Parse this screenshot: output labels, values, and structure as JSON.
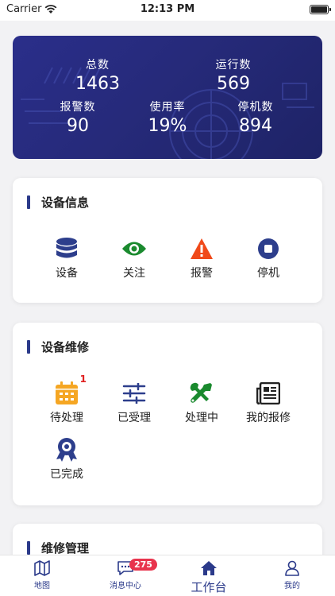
{
  "status_bar": {
    "carrier": "Carrier",
    "time": "12:13 PM"
  },
  "summary": {
    "total_label": "总数",
    "total_value": "1463",
    "running_label": "运行数",
    "running_value": "569",
    "alarm_label": "报警数",
    "alarm_value": "90",
    "usage_label": "使用率",
    "usage_value": "19%",
    "stopped_label": "停机数",
    "stopped_value": "894"
  },
  "device_info": {
    "title": "设备信息",
    "items": [
      {
        "label": "设备",
        "icon": "database-icon",
        "color": "#2d3e8c"
      },
      {
        "label": "关注",
        "icon": "eye-icon",
        "color": "#1a8a2e"
      },
      {
        "label": "报警",
        "icon": "warning-icon",
        "color": "#f04a1a"
      },
      {
        "label": "停机",
        "icon": "stop-icon",
        "color": "#2d3e8c"
      }
    ]
  },
  "repair": {
    "title": "设备维修",
    "items": [
      {
        "label": "待处理",
        "icon": "calendar-icon",
        "badge": "1",
        "color": "#f5a623"
      },
      {
        "label": "已受理",
        "icon": "sliders-icon",
        "color": "#2d3e8c"
      },
      {
        "label": "处理中",
        "icon": "tools-icon",
        "color": "#1a8a2e"
      },
      {
        "label": "我的报修",
        "icon": "newspaper-icon",
        "color": "#222222"
      },
      {
        "label": "已完成",
        "icon": "award-icon",
        "color": "#2d3e8c"
      }
    ]
  },
  "maintenance": {
    "title": "维修管理"
  },
  "tabbar": {
    "items": [
      {
        "label": "地图",
        "icon": "map-icon"
      },
      {
        "label": "消息中心",
        "icon": "chat-icon",
        "badge": "275"
      },
      {
        "label": "工作台",
        "icon": "home-icon",
        "active": true
      },
      {
        "label": "我的",
        "icon": "user-icon"
      }
    ]
  }
}
